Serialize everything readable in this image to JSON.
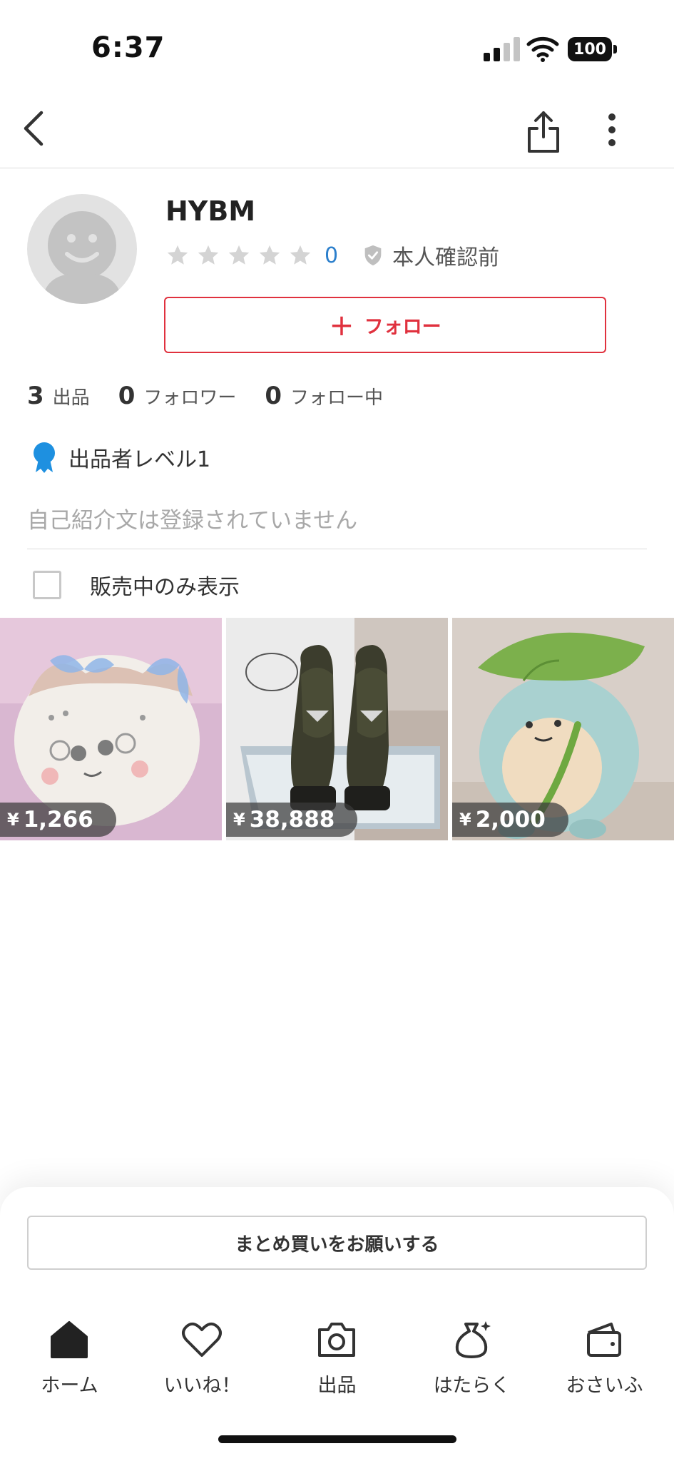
{
  "status_bar": {
    "time": "6:37",
    "battery": "100"
  },
  "nav": {
    "back_icon": "chevron-left-icon",
    "share_icon": "share-icon",
    "more_icon": "more-vertical-icon"
  },
  "profile": {
    "username": "HYBM",
    "rating_stars": 0,
    "rating_count": "0",
    "verification_status": "本人確認前",
    "follow_button": "フォロー"
  },
  "counts": [
    {
      "value": "3",
      "label": "出品"
    },
    {
      "value": "0",
      "label": "フォロワー"
    },
    {
      "value": "0",
      "label": "フォロー中"
    }
  ],
  "seller_level": "出品者レベル1",
  "bio": "自己紹介文は登録されていません",
  "filter": {
    "label": "販売中のみ表示",
    "checked": false
  },
  "items": [
    {
      "yen": "¥",
      "price": "1,266",
      "image": "plush-cat-pouch"
    },
    {
      "yen": "¥",
      "price": "38,888",
      "image": "loafers-in-box"
    },
    {
      "yen": "¥",
      "price": "2,000",
      "image": "plush-with-leaf"
    }
  ],
  "bulk_request_button": "まとめ買いをお願いする",
  "tabs": [
    {
      "label": "ホーム",
      "icon": "home-icon"
    },
    {
      "label": "いいね！",
      "icon": "heart-icon"
    },
    {
      "label": "出品",
      "icon": "camera-icon"
    },
    {
      "label": "はたらく",
      "icon": "money-bag-icon"
    },
    {
      "label": "おさいふ",
      "icon": "wallet-icon"
    }
  ],
  "colors": {
    "accent": "#e0313e",
    "link": "#2b7fcc",
    "badge": "#1e90e0"
  }
}
